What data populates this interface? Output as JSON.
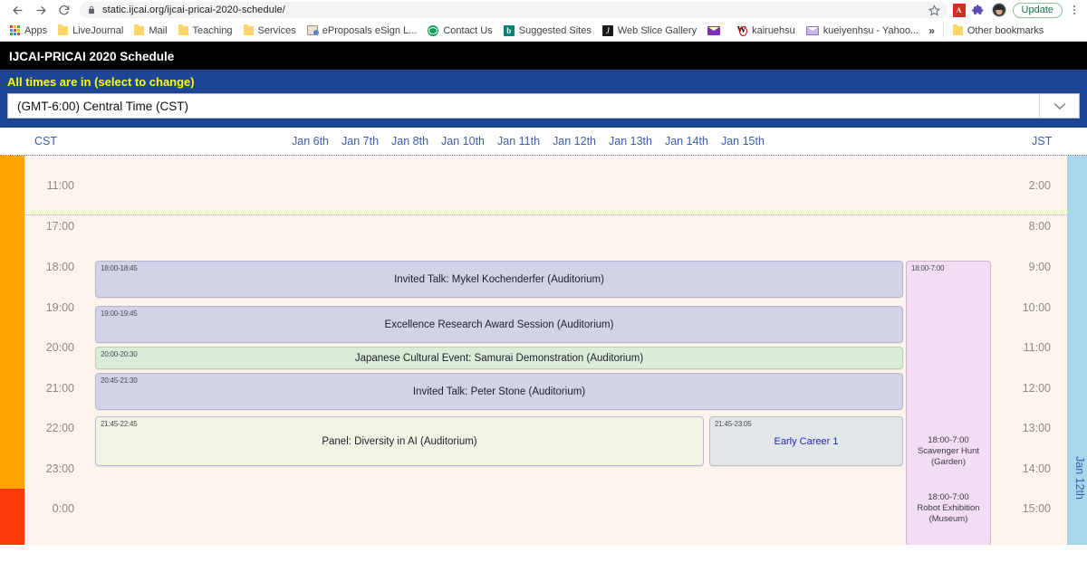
{
  "browser": {
    "back_icon": "back-arrow-icon",
    "forward_icon": "forward-arrow-icon",
    "reload_icon": "reload-icon",
    "lock_icon": "lock-icon",
    "url": "static.ijcai.org/ijcai-pricai-2020-schedule/",
    "star_icon": "bookmark-star-icon",
    "extensions": [
      {
        "name": "pdf-extension-icon",
        "glyph": "A"
      },
      {
        "name": "extensions-puzzle-icon"
      }
    ],
    "avatar_name": "profile-avatar",
    "update_label": "Update",
    "menu_icon": "chrome-menu-icon",
    "bookmarks": [
      {
        "label": "Apps",
        "icon": "apps-grid-icon"
      },
      {
        "label": "LiveJournal",
        "icon": "folder-icon"
      },
      {
        "label": "Mail",
        "icon": "folder-icon"
      },
      {
        "label": "Teaching",
        "icon": "folder-icon"
      },
      {
        "label": "Services",
        "icon": "folder-icon"
      },
      {
        "label": "eProposals eSign L...",
        "icon": "eproposals-icon"
      },
      {
        "label": "Contact Us",
        "icon": "globe-icon"
      },
      {
        "label": "Suggested Sites",
        "icon": "bing-icon"
      },
      {
        "label": "Web Slice Gallery",
        "icon": "webslice-icon"
      },
      {
        "label": "",
        "icon": "purple-mail-icon"
      },
      {
        "label": "kairuehsu",
        "icon": "word-icon"
      },
      {
        "label": "kueiyenhsu - Yahoo...",
        "icon": "mail-icon"
      }
    ],
    "overflow_label": "»",
    "other_bookmarks_label": "Other bookmarks"
  },
  "site": {
    "header_title": "IJCAI-PRICAI 2020 Schedule",
    "timezone_label": "All times are in (select to change)",
    "timezone_value": "(GMT-6:00) Central Time (CST)",
    "chevron_icon": "chevron-down-icon"
  },
  "schedule": {
    "left_tz": "CST",
    "right_tz": "JST",
    "days": [
      "Jan 6th",
      "Jan 7th",
      "Jan 8th",
      "Jan 10th",
      "Jan 11th",
      "Jan 12th",
      "Jan 13th",
      "Jan 14th",
      "Jan 15th"
    ],
    "side_day_label": "Jan 12th",
    "left_hours": [
      "11:00",
      "17:00",
      "18:00",
      "19:00",
      "20:00",
      "21:00",
      "22:00",
      "23:00",
      "0:00"
    ],
    "right_hours": [
      "2:00",
      "8:00",
      "9:00",
      "10:00",
      "11:00",
      "12:00",
      "13:00",
      "14:00",
      "15:00"
    ],
    "events": [
      {
        "time": "18:00-18:45",
        "title": "Invited Talk: Mykel Kochenderfer (Auditorium)",
        "style": "ev-purple"
      },
      {
        "time": "19:00-19:45",
        "title": "Excellence Research Award Session (Auditorium)",
        "style": "ev-purple"
      },
      {
        "time": "20:00-20:30",
        "title": "Japanese Cultural Event: Samurai Demonstration (Auditorium)",
        "style": "ev-green"
      },
      {
        "time": "20:45-21:30",
        "title": "Invited Talk: Peter Stone (Auditorium)",
        "style": "ev-purple"
      },
      {
        "time": "21:45-22:45",
        "title": "Panel: Diversity in AI (Auditorium)",
        "style": "ev-cream"
      },
      {
        "time": "21:45-23:05",
        "title": "Early Career 1",
        "style": "ev-gray",
        "link": true
      }
    ],
    "allday": {
      "time": "18:00-7:00",
      "items": [
        {
          "line1": "18:00-7:00",
          "line2": "Scavenger Hunt",
          "line3": "(Garden)"
        },
        {
          "line1": "18:00-7:00",
          "line2": "Robot Exhibition",
          "line3": "(Museum)"
        }
      ]
    }
  }
}
